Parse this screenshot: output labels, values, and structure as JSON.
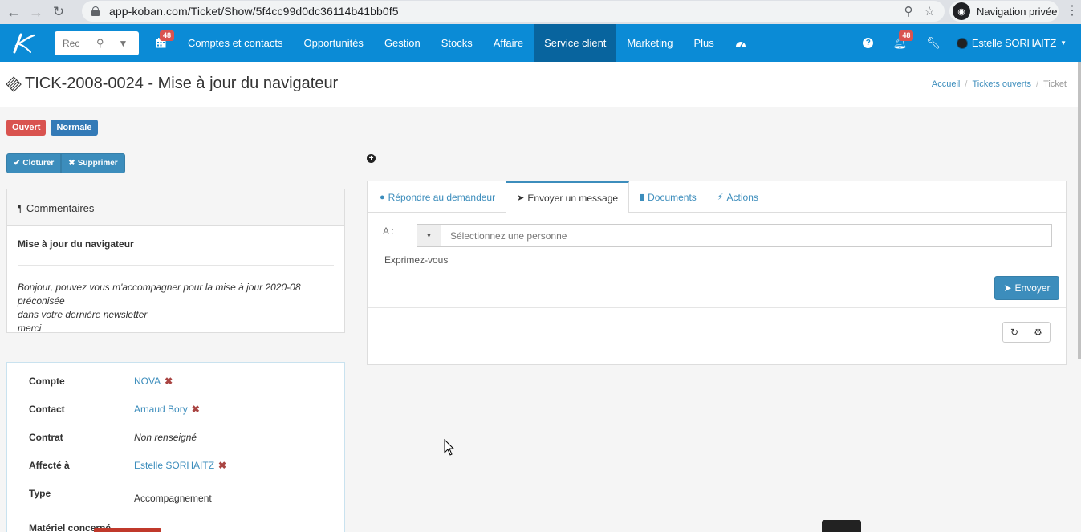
{
  "browser": {
    "url": "app-koban.com/Ticket/Show/5f4cc99d0dc36114b41bb0f5",
    "incognito_label": "Navigation privée"
  },
  "navbar": {
    "search_placeholder": "Rec",
    "calendar_badge": "48",
    "items": [
      "Comptes et contacts",
      "Opportunités",
      "Gestion",
      "Stocks",
      "Affaire",
      "Service client",
      "Marketing",
      "Plus"
    ],
    "notifications_badge": "48",
    "user_name": "Estelle SORHAITZ"
  },
  "page": {
    "title": "TICK-2008-0024 - Mise à jour du navigateur",
    "breadcrumb": [
      "Accueil",
      "Tickets ouverts",
      "Ticket"
    ]
  },
  "status": {
    "state": "Ouvert",
    "priority": "Normale"
  },
  "actions": {
    "close_label": "Cloturer",
    "delete_label": "Supprimer"
  },
  "comments": {
    "heading": "Commentaires",
    "title": "Mise à jour du navigateur",
    "body_line1": "Bonjour, pouvez vous m'accompagner pour la mise à jour 2020-08 préconisée",
    "body_line2": "dans votre dernière newsletter",
    "body_line3": "merci"
  },
  "info": {
    "compte_label": "Compte",
    "compte_value": "NOVA",
    "contact_label": "Contact",
    "contact_value": "Arnaud Bory",
    "contrat_label": "Contrat",
    "contrat_value": "Non renseigné",
    "affecte_label": "Affecté à",
    "affecte_value": "Estelle SORHAITZ",
    "type_label": "Type",
    "type_value": "Accompagnement",
    "materiel_label": "Matériel concerné"
  },
  "tabs": {
    "items": [
      "Répondre au demandeur",
      "Envoyer un message",
      "Documents",
      "Actions"
    ],
    "to_label": "A :",
    "select_placeholder": "Sélectionnez une personne",
    "express_label": "Exprimez-vous",
    "send_label": "Envoyer"
  }
}
